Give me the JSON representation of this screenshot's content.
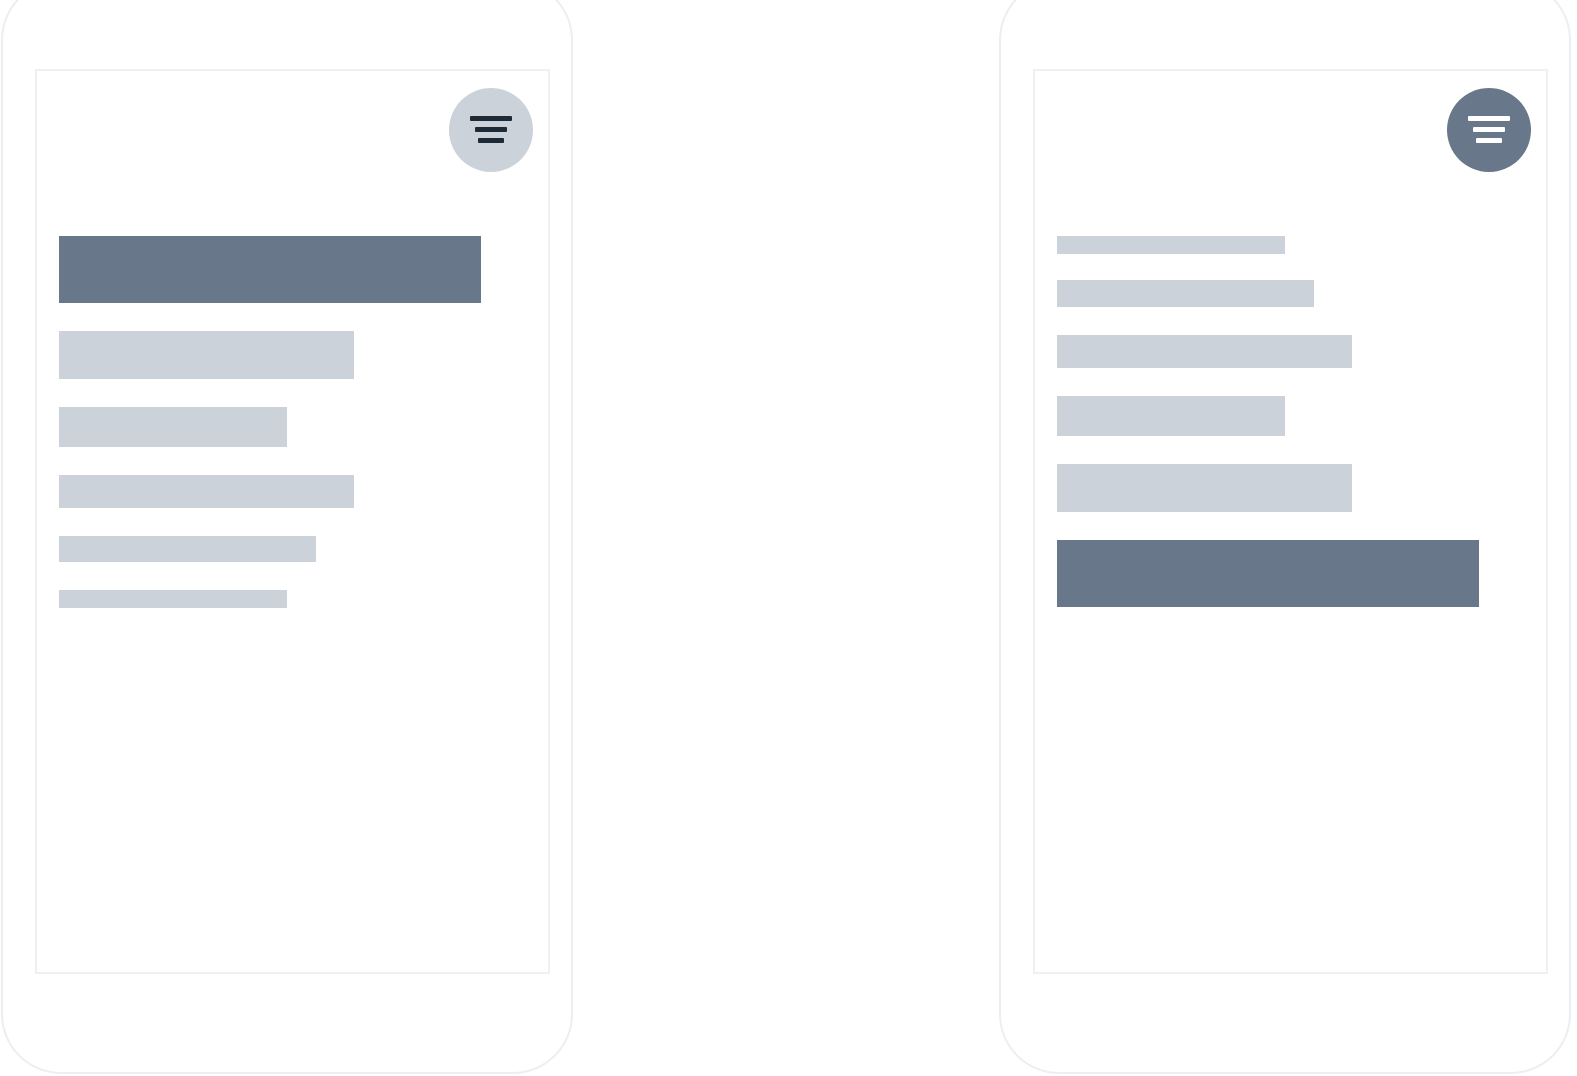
{
  "colors": {
    "bar_active": "#687789",
    "bar_inactive": "#cbd2da",
    "icon_dark": "#1e2a36",
    "icon_light": "#ffffff"
  },
  "screens": [
    {
      "sort_button": {
        "icon": "sort-descending-icon",
        "state": "inactive"
      },
      "order": "descending",
      "bars": [
        {
          "relative_value": 1.0,
          "highlighted": true
        },
        {
          "relative_value": 0.7,
          "highlighted": false
        },
        {
          "relative_value": 0.54,
          "highlighted": false
        },
        {
          "relative_value": 0.7,
          "highlighted": false
        },
        {
          "relative_value": 0.61,
          "highlighted": false
        },
        {
          "relative_value": 0.54,
          "highlighted": false
        }
      ]
    },
    {
      "sort_button": {
        "icon": "sort-descending-icon",
        "state": "active"
      },
      "order": "ascending",
      "bars": [
        {
          "relative_value": 0.54,
          "highlighted": false
        },
        {
          "relative_value": 0.61,
          "highlighted": false
        },
        {
          "relative_value": 0.7,
          "highlighted": false
        },
        {
          "relative_value": 0.54,
          "highlighted": false
        },
        {
          "relative_value": 0.7,
          "highlighted": false
        },
        {
          "relative_value": 1.0,
          "highlighted": true
        }
      ]
    }
  ]
}
